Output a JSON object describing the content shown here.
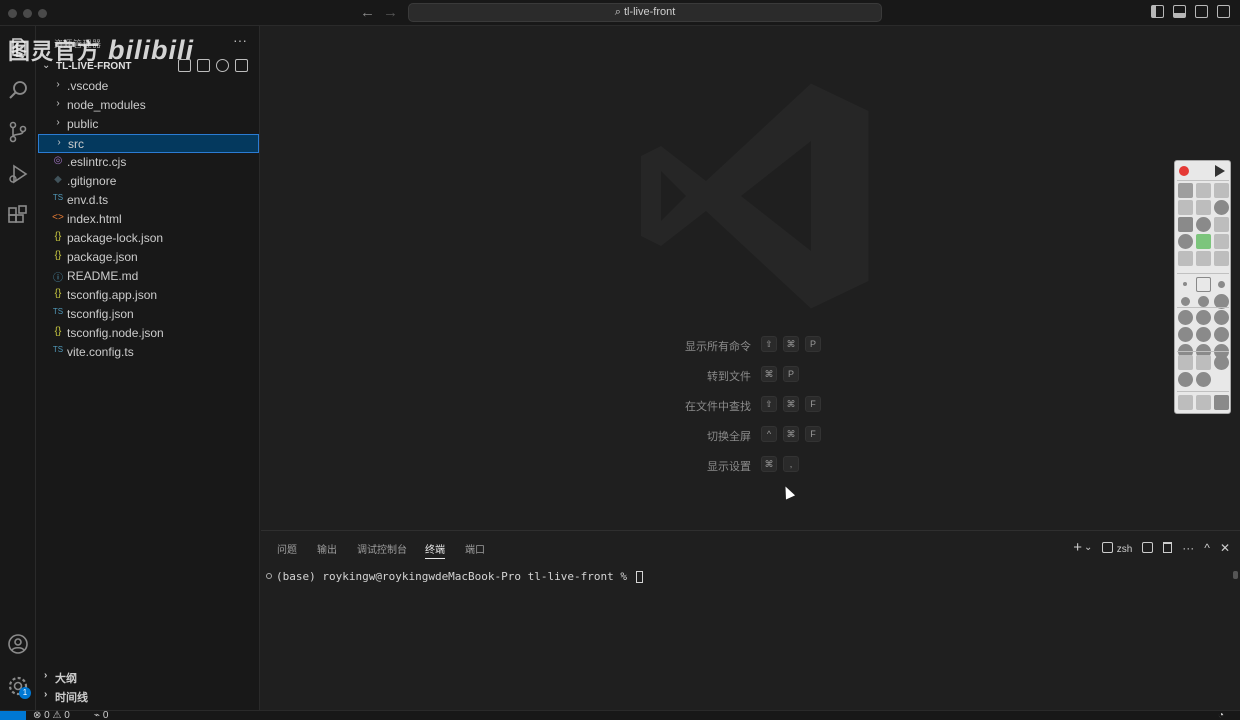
{
  "title_bar": {
    "search_text": "tl-live-front",
    "back": "←",
    "forward": "→"
  },
  "sidebar": {
    "header": "资源管理器",
    "more": "···",
    "project": "TL-LIVE-FRONT",
    "items": [
      {
        "name": ".vscode",
        "icon": "›",
        "icon_color": "#cccccc"
      },
      {
        "name": "node_modules",
        "icon": "›",
        "icon_color": "#cccccc"
      },
      {
        "name": "public",
        "icon": "›",
        "icon_color": "#cccccc"
      },
      {
        "name": "src",
        "icon": "›",
        "icon_color": "#cccccc"
      },
      {
        "name": ".eslintrc.cjs",
        "icon": "◎",
        "icon_color": "#a074c4"
      },
      {
        "name": ".gitignore",
        "icon": "◆",
        "icon_color": "#41535b"
      },
      {
        "name": "env.d.ts",
        "icon": "TS",
        "icon_color": "#519aba"
      },
      {
        "name": "index.html",
        "icon": "<>",
        "icon_color": "#e37933"
      },
      {
        "name": "package-lock.json",
        "icon": "{}",
        "icon_color": "#cbcb41"
      },
      {
        "name": "package.json",
        "icon": "{}",
        "icon_color": "#cbcb41"
      },
      {
        "name": "README.md",
        "icon": "ⓘ",
        "icon_color": "#519aba"
      },
      {
        "name": "tsconfig.app.json",
        "icon": "{}",
        "icon_color": "#cbcb41"
      },
      {
        "name": "tsconfig.json",
        "icon": "TS",
        "icon_color": "#519aba"
      },
      {
        "name": "tsconfig.node.json",
        "icon": "{}",
        "icon_color": "#cbcb41"
      },
      {
        "name": "vite.config.ts",
        "icon": "TS",
        "icon_color": "#519aba"
      }
    ],
    "outline": "大纲",
    "timeline": "时间线"
  },
  "watermark": {
    "text": "图灵官方",
    "brand": "bilibili"
  },
  "editor": {
    "shortcuts": [
      {
        "label": "显示所有命令",
        "keys": [
          "⇧",
          "⌘",
          "P"
        ]
      },
      {
        "label": "转到文件",
        "keys": [
          "⌘",
          "P"
        ]
      },
      {
        "label": "在文件中查找",
        "keys": [
          "⇧",
          "⌘",
          "F"
        ]
      },
      {
        "label": "切换全屏",
        "keys": [
          "^",
          "⌘",
          "F"
        ]
      },
      {
        "label": "显示设置",
        "keys": [
          "⌘",
          ","
        ]
      }
    ]
  },
  "panel": {
    "tabs": [
      "问题",
      "输出",
      "调试控制台",
      "终端",
      "端口"
    ],
    "active_tab": "终端",
    "shell": "zsh",
    "add": "+",
    "split_caret": "⌄",
    "more": "···",
    "maximize": "^",
    "close": "✕",
    "prompt": "(base) roykingw@roykingwdeMacBook-Pro tl-live-front % "
  },
  "status_bar": {
    "errors": "0",
    "warnings": "0",
    "ports": "0",
    "accounts_badge": "1"
  },
  "colors": {
    "selection_bg": "#04395e",
    "selection_border": "#2b7cd3",
    "remote_bg": "#0078d4",
    "record": "#e53935"
  }
}
